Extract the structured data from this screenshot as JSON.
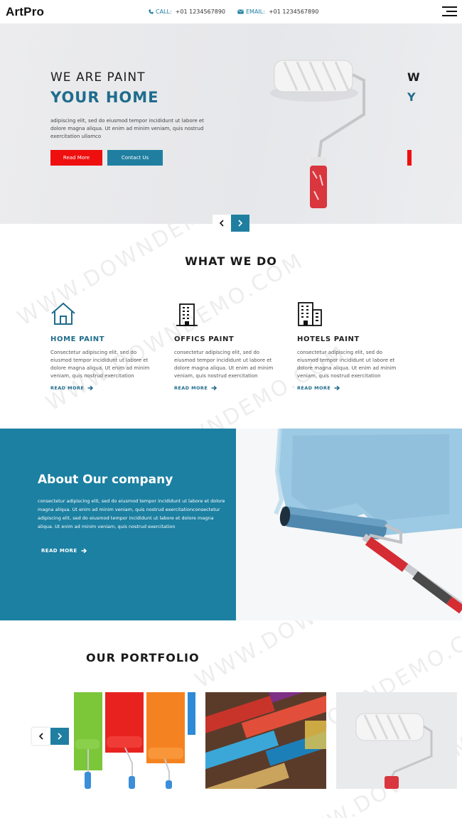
{
  "header": {
    "logo": "ArtPro",
    "call_label": "CALL:",
    "call_value": "+01 1234567890",
    "email_label": "EMAIL:",
    "email_value": "+01 1234567890"
  },
  "hero": {
    "title_line1": "WE ARE PAINT",
    "title_line2": "YOUR HOME",
    "text": "adipiscing elit, sed do eiusmod tempor incididunt ut labore et dolore magna aliqua. Ut enim ad minim veniam, quis nostrud exercitation ullamco",
    "read_more": "Read More",
    "contact_us": "Contact Us",
    "peek_line1": "W",
    "peek_line2": "Y"
  },
  "what_we_do": {
    "title": "WHAT WE DO",
    "services": [
      {
        "title": "HOME PAINT",
        "text": "Consectetur adipiscing elit, sed do eiusmod tempor incididunt ut labore et dolore magna aliqua. Ut enim ad minim veniam, quis nostrud exercitation",
        "more": "READ MORE",
        "icon": "house-icon"
      },
      {
        "title": "OFFICS PAINT",
        "text": "consectetur adipiscing elit, sed do eiusmod tempor incididunt ut labore et dolore magna aliqua. Ut enim ad minim veniam, quis nostrud exercitation",
        "more": "READ MORE",
        "icon": "office-building-icon"
      },
      {
        "title": "HOTELS PAINT",
        "text": "consectetur adipiscing elit, sed do eiusmod tempor incididunt ut labore et dolore magna aliqua. Ut enim ad minim veniam, quis nostrud exercitation",
        "more": "READ MORE",
        "icon": "hotel-building-icon"
      }
    ]
  },
  "about": {
    "title": "About Our company",
    "text": "consectetur adipiscing elit, sed do eiusmod tempor incididunt ut labore et dolore magna aliqua. Ut enim ad minim veniam, quis nostrud exercitationconsectetur adipiscing elit, sed do eiusmod tempor incididunt ut labore et dolore magna aliqua. Ut enim ad minim veniam, quis nostrud exercitation",
    "more": "READ MORE"
  },
  "portfolio": {
    "title": "OUR PORTFOLIO"
  },
  "watermark": "WWW.DOWNDEMO.COM",
  "colors": {
    "accent_teal": "#207fa1",
    "accent_red": "#ef0f0f",
    "about_bg": "#1c80a2"
  }
}
